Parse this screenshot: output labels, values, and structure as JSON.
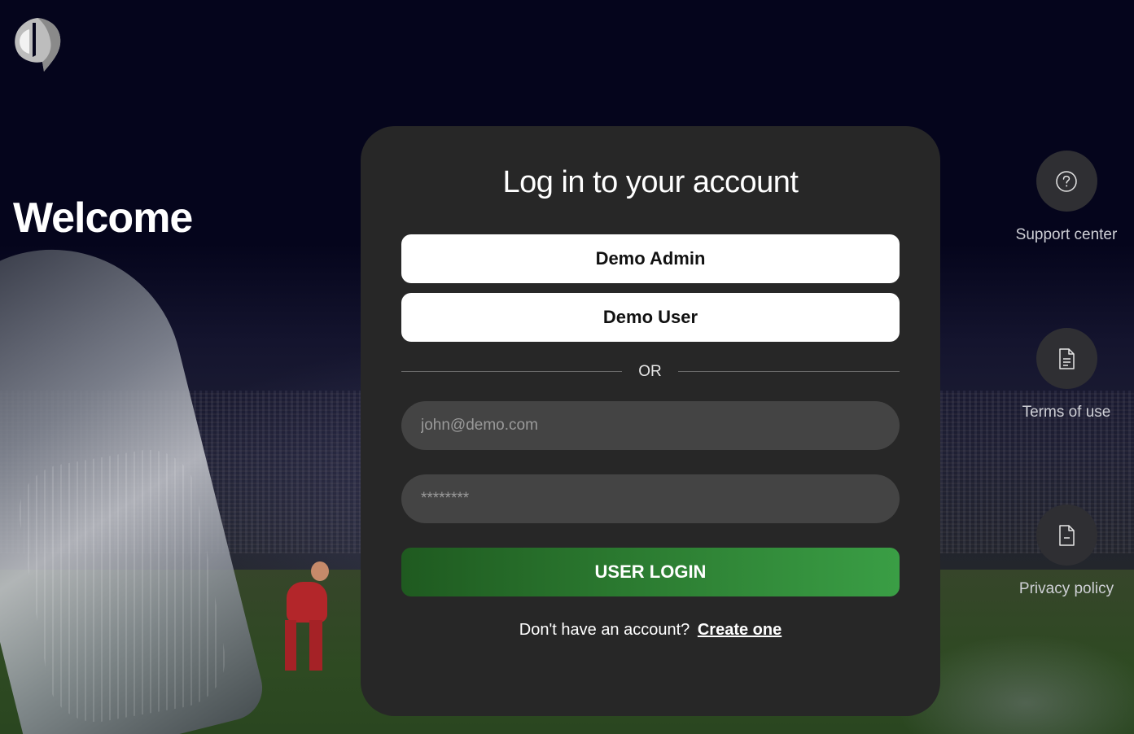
{
  "page": {
    "welcome_text": "Welcome"
  },
  "logo": {
    "icon": "brand-logo-icon"
  },
  "login_card": {
    "title": "Log in to your account",
    "demo_admin_label": "Demo Admin",
    "demo_user_label": "Demo User",
    "divider_text": "OR",
    "email": {
      "placeholder": "john@demo.com",
      "value": ""
    },
    "password": {
      "placeholder": "********",
      "value": ""
    },
    "login_button_label": "USER LOGIN",
    "signup_prompt": "Don't have an account?",
    "signup_link": "Create one"
  },
  "side_links": [
    {
      "label": "Support center",
      "icon": "question-circle-icon"
    },
    {
      "label": "Terms of use",
      "icon": "document-icon"
    },
    {
      "label": "Privacy policy",
      "icon": "file-minus-icon"
    }
  ],
  "colors": {
    "background": "#05051c",
    "card": "#272727",
    "input": "#444444",
    "login_button_start": "#1f5a20",
    "login_button_end": "#3a9e45",
    "side_circle": "#2f2f33"
  }
}
